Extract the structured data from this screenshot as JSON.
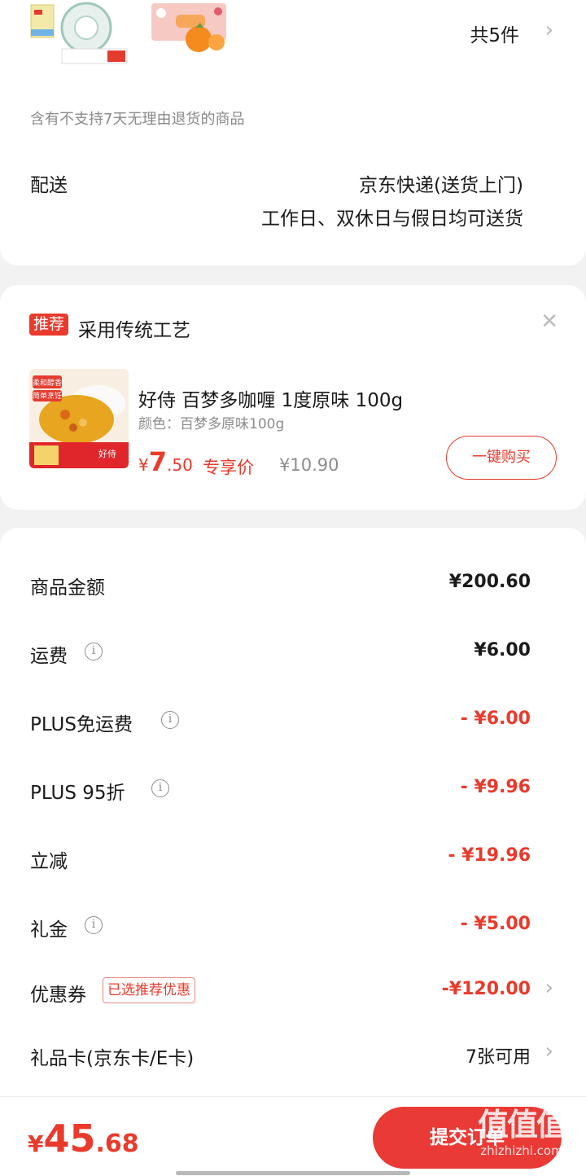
{
  "products": {
    "count_label": "共5件",
    "no_return_notice": "含有不支持7天无理由退货的商品"
  },
  "shipping": {
    "label": "配送",
    "method": "京东快递(送货上门)",
    "schedule": "工作日、双休日与假日均可送货"
  },
  "recommend": {
    "badge": "推荐",
    "title": "采用传统工艺",
    "product_name": "好侍 百梦多咖喱 1度原味 100g",
    "spec": "颜色：百梦多原味100g",
    "price_symbol": "¥",
    "price_int": "7",
    "price_dec": ".50",
    "price_tag": "专享价",
    "original_price": "¥10.90",
    "buy_button": "一键购买",
    "image_text_1": "柔和醇香",
    "image_text_2": "简单烹饪",
    "image_brand": "好侍"
  },
  "summary": {
    "rows": [
      {
        "label": "商品金额",
        "value": "¥200.60"
      },
      {
        "label": "运费",
        "value": "¥6.00"
      },
      {
        "label": "PLUS免运费",
        "value": "- ¥6.00"
      },
      {
        "label": "PLUS 95折",
        "value": "- ¥9.96"
      },
      {
        "label": "立减",
        "value": "- ¥19.96"
      },
      {
        "label": "礼金",
        "value": "- ¥5.00"
      },
      {
        "label": "优惠券",
        "value": "-¥120.00",
        "tag": "已选推荐优惠"
      },
      {
        "label": "礼品卡(京东卡/E卡)",
        "value": "7张可用"
      }
    ]
  },
  "footer": {
    "total_symbol": "¥",
    "total_int": "45",
    "total_dec": ".68",
    "submit_label": "提交订单"
  },
  "watermark": {
    "top": "值值值",
    "bottom": "zhizhizhi.com"
  },
  "colors": {
    "accent": "#e93a2c",
    "background": "#f2f2f2"
  }
}
